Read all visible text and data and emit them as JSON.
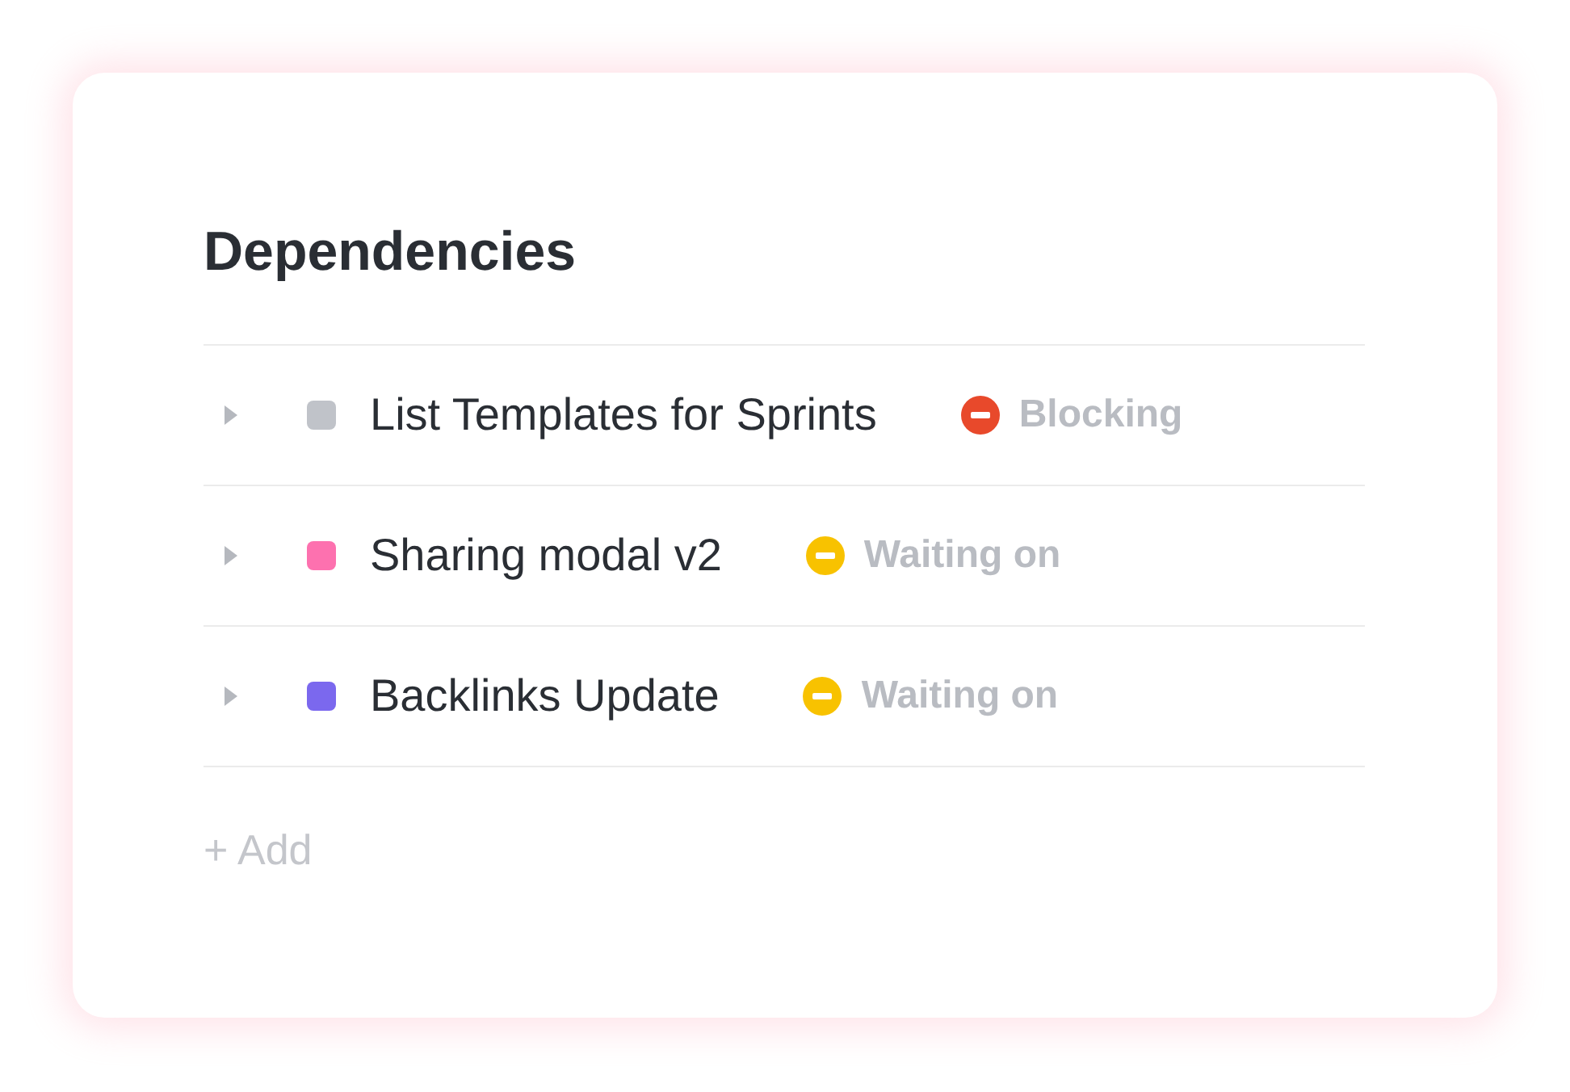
{
  "title": "Dependencies",
  "rows": [
    {
      "name": "List Templates for Sprints",
      "color": "#c0c3c9",
      "status": {
        "kind": "blocking",
        "label": "Blocking"
      }
    },
    {
      "name": "Sharing modal v2",
      "color": "#fd71af",
      "status": {
        "kind": "waiting",
        "label": "Waiting on"
      }
    },
    {
      "name": "Backlinks Update",
      "color": "#7b68ee",
      "status": {
        "kind": "waiting",
        "label": "Waiting on"
      }
    }
  ],
  "add_button": "+ Add"
}
